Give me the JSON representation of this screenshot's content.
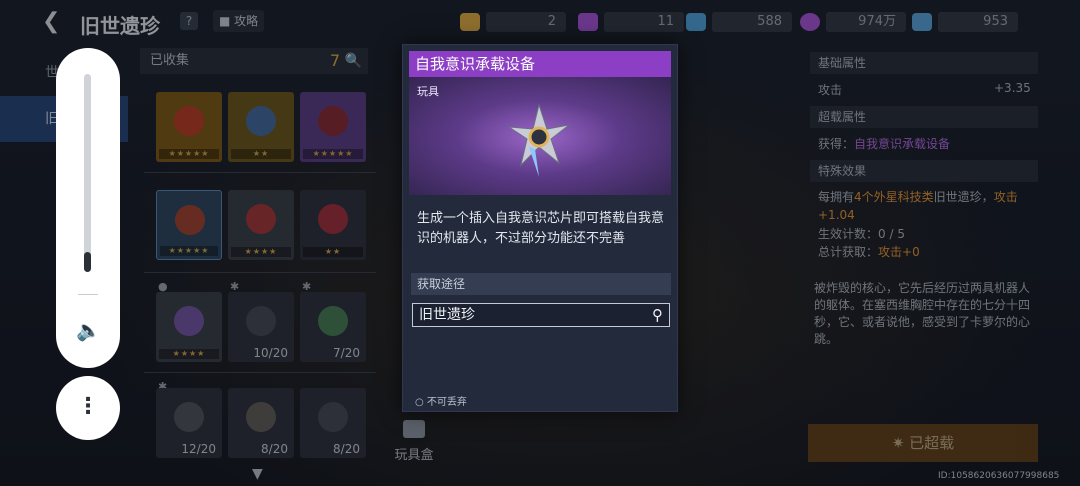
{
  "header": {
    "back_icon": "arrow-left-icon",
    "title": "旧世遗珍",
    "help": "?",
    "guide_label": "攻略",
    "resources": [
      {
        "icon": "gold-trophy-icon",
        "value": "2",
        "color": "#d9a948"
      },
      {
        "icon": "purple-trophy-icon",
        "value": "11",
        "color": "#a455d6"
      },
      {
        "icon": "blue-trophy-icon",
        "value": "588",
        "color": "#4f9ed8"
      },
      {
        "icon": "purple-coin-icon",
        "value": "974万",
        "color": "#a455d6"
      },
      {
        "icon": "chip-icon",
        "value": "953",
        "color": "#5aa0d8"
      }
    ]
  },
  "left_tabs": [
    {
      "label": "世界之树"
    },
    {
      "label": "旧世遗珍"
    }
  ],
  "collection": {
    "header_label": "已收集",
    "count": "7",
    "items": [
      {
        "stars": "★★★★★",
        "count": "",
        "color": "#c0392b"
      },
      {
        "stars": "★★",
        "count": "",
        "color": "#3d6fb5"
      },
      {
        "stars": "★★★★★",
        "count": "",
        "color": "#8e2a2a"
      },
      {
        "stars": "★★★★★",
        "count": "",
        "color": "#b3442b"
      },
      {
        "stars": "★★★★",
        "count": "",
        "color": "#b33a3a"
      },
      {
        "stars": "★★",
        "count": "",
        "color": "#b0333f"
      },
      {
        "stars": "★★★★",
        "count": "",
        "color": "#7e5bb5"
      },
      {
        "stars": "",
        "count": "10/20",
        "color": "#4a4f5a"
      },
      {
        "stars": "",
        "count": "7/20",
        "color": "#4e8a5a"
      },
      {
        "stars": "",
        "count": "12/20",
        "color": "#555a63"
      },
      {
        "stars": "",
        "count": "8/20",
        "color": "#6b6660"
      },
      {
        "stars": "",
        "count": "8/20",
        "color": "#4a4f5a"
      }
    ]
  },
  "toybox_label": "玩具盒",
  "popup": {
    "title": "自我意识承载设备",
    "type": "玩具",
    "description": "生成一个插入自我意识芯片即可搭载自我意识的机器人，不过部分功能还不完善",
    "source_header": "获取途径",
    "source_value": "旧世遗珍",
    "footer": "不可丢弃"
  },
  "right_panel": {
    "base_attr_header": "基础属性",
    "attack_label": "攻击",
    "attack_value": "+3.35",
    "extra_attr_header": "超载属性",
    "obtain_label": "获得：",
    "obtain_value": "自我意识承载设备",
    "special_header": "特殊效果",
    "special_pre": "每拥有",
    "special_num": "4个",
    "special_mid": "外星科技类",
    "special_post": "旧世遗珍，",
    "special_effect": "攻击+1.04",
    "effect_count_label": "生效计数：",
    "effect_count_value": "0 / 5",
    "total_label": "总计获取：",
    "total_value": "攻击+0",
    "lore": "被炸毁的核心，它先后经历过两具机器人的躯体。在塞西维胸腔中存在的七分十四秒，它、或者说他，感受到了卡萝尔的心跳。",
    "claimed_label": "已超载"
  },
  "uid": "ID:1058620636077998685",
  "volume": {
    "level": 0.1
  }
}
